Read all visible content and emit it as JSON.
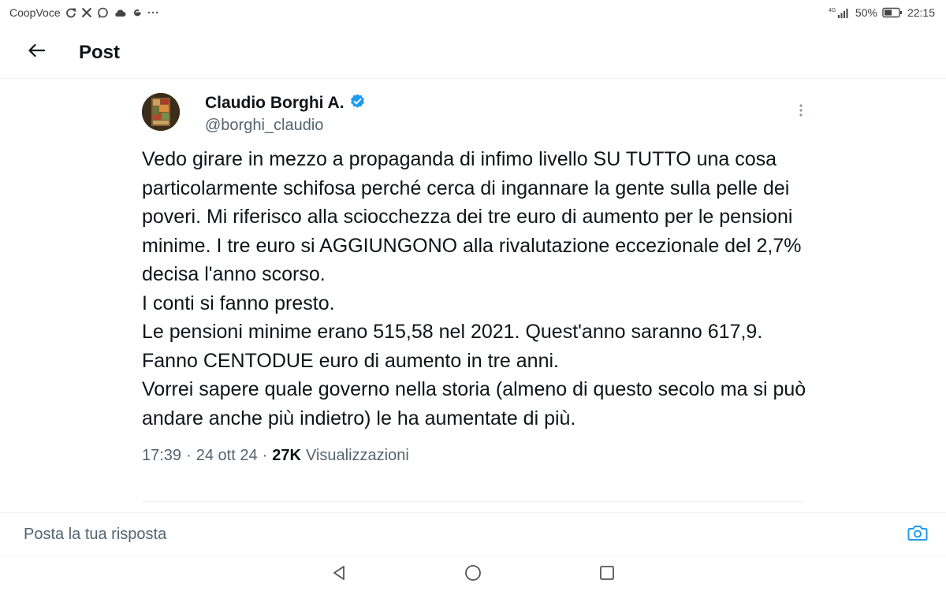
{
  "status_bar": {
    "carrier": "CoopVoce",
    "notification_icons": [
      "sync-icon",
      "x-logo-icon",
      "whatsapp-icon",
      "cloud-icon",
      "google-icon",
      "more-dots-icon"
    ],
    "network": "4G",
    "battery": "50%",
    "time": "22:15"
  },
  "header": {
    "title": "Post"
  },
  "tweet": {
    "author": {
      "name": "Claudio Borghi A.",
      "handle": "@borghi_claudio",
      "verified": true
    },
    "paragraphs": [
      "Vedo girare in mezzo a propaganda di infimo livello SU TUTTO una cosa particolarmente schifosa perché cerca di ingannare la gente sulla pelle dei poveri. Mi riferisco alla sciocchezza dei tre euro di aumento per le pensioni minime. I tre euro si AGGIUNGONO alla rivalutazione eccezionale del 2,7% decisa l'anno scorso.",
      "I conti si fanno presto.",
      "Le pensioni minime erano 515,58 nel 2021. Quest'anno saranno 617,9.",
      "Fanno CENTODUE euro di aumento in tre anni.",
      "Vorrei sapere quale governo nella storia (almeno di questo secolo ma si può andare anche più indietro) le ha aumentate di più."
    ],
    "meta": {
      "time": "17:39",
      "separator": "·",
      "date": "24 ott 24",
      "views_count": "27K",
      "views_label": "Visualizzazioni"
    }
  },
  "reply": {
    "placeholder": "Posta la tua risposta"
  },
  "colors": {
    "verified_badge": "#1d9bf0",
    "accent": "#1d9bf0",
    "text_primary": "#0f1419",
    "text_secondary": "#536471"
  }
}
